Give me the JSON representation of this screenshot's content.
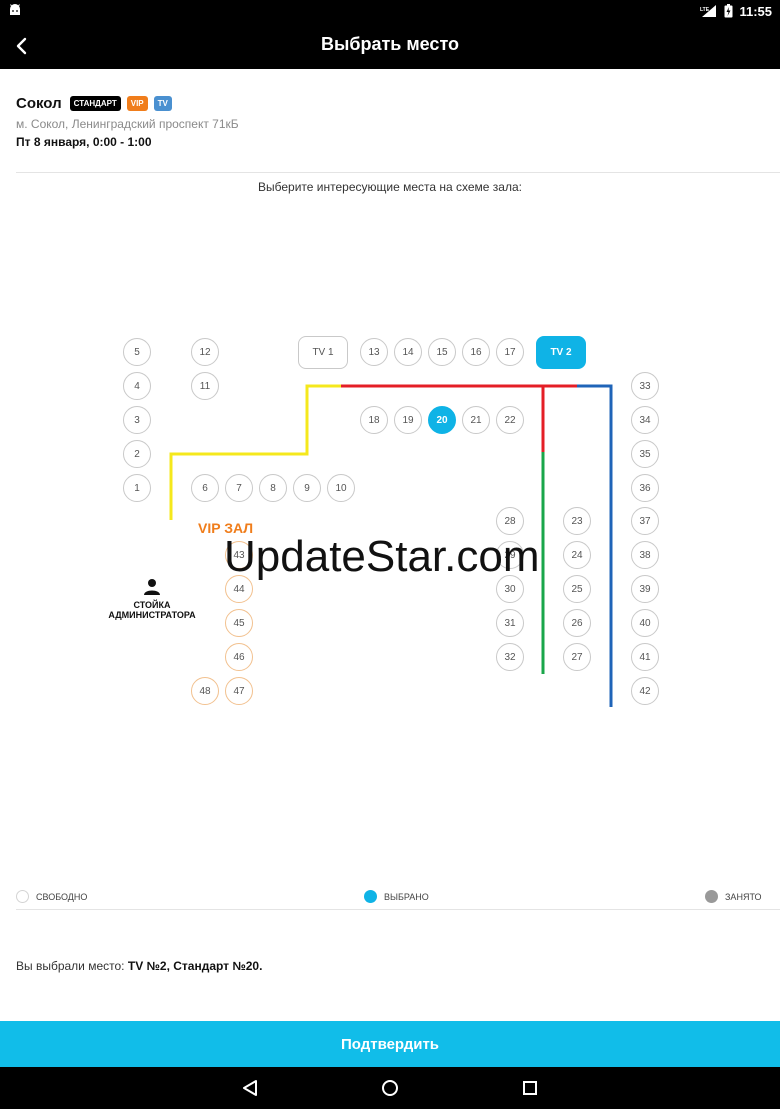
{
  "status_bar": {
    "time": "11:55",
    "network": "LTE"
  },
  "app_bar": {
    "title": "Выбрать место"
  },
  "venue": {
    "name": "Сокол",
    "badges": [
      "СТАНДАРТ",
      "VIP",
      "TV"
    ],
    "address": "м. Сокол, Ленинградский проспект 71кБ",
    "date": "Пт 8 января, 0:00 - 1:00"
  },
  "instruction": "Выберите интересующие места на схеме зала:",
  "hall": {
    "seats": [
      {
        "label": "5",
        "type": "standard",
        "state": "free"
      },
      {
        "label": "4",
        "type": "standard",
        "state": "free"
      },
      {
        "label": "3",
        "type": "standard",
        "state": "free"
      },
      {
        "label": "2",
        "type": "standard",
        "state": "free"
      },
      {
        "label": "1",
        "type": "standard",
        "state": "free"
      },
      {
        "label": "12",
        "type": "standard",
        "state": "free"
      },
      {
        "label": "11",
        "type": "standard",
        "state": "free"
      },
      {
        "label": "TV 1",
        "type": "tv",
        "state": "free"
      },
      {
        "label": "13",
        "type": "standard",
        "state": "free"
      },
      {
        "label": "14",
        "type": "standard",
        "state": "free"
      },
      {
        "label": "15",
        "type": "standard",
        "state": "free"
      },
      {
        "label": "16",
        "type": "standard",
        "state": "free"
      },
      {
        "label": "17",
        "type": "standard",
        "state": "free"
      },
      {
        "label": "TV 2",
        "type": "tv",
        "state": "selected"
      },
      {
        "label": "18",
        "type": "standard",
        "state": "free"
      },
      {
        "label": "19",
        "type": "standard",
        "state": "free"
      },
      {
        "label": "20",
        "type": "standard",
        "state": "selected"
      },
      {
        "label": "21",
        "type": "standard",
        "state": "free"
      },
      {
        "label": "22",
        "type": "standard",
        "state": "free"
      },
      {
        "label": "6",
        "type": "standard",
        "state": "free"
      },
      {
        "label": "7",
        "type": "standard",
        "state": "free"
      },
      {
        "label": "8",
        "type": "standard",
        "state": "free"
      },
      {
        "label": "9",
        "type": "standard",
        "state": "free"
      },
      {
        "label": "10",
        "type": "standard",
        "state": "free"
      },
      {
        "label": "28",
        "type": "standard",
        "state": "free"
      },
      {
        "label": "29",
        "type": "standard",
        "state": "free"
      },
      {
        "label": "30",
        "type": "standard",
        "state": "free"
      },
      {
        "label": "31",
        "type": "standard",
        "state": "free"
      },
      {
        "label": "32",
        "type": "standard",
        "state": "free"
      },
      {
        "label": "23",
        "type": "standard",
        "state": "free"
      },
      {
        "label": "24",
        "type": "standard",
        "state": "free"
      },
      {
        "label": "25",
        "type": "standard",
        "state": "free"
      },
      {
        "label": "26",
        "type": "standard",
        "state": "free"
      },
      {
        "label": "27",
        "type": "standard",
        "state": "free"
      },
      {
        "label": "33",
        "type": "standard",
        "state": "free"
      },
      {
        "label": "34",
        "type": "standard",
        "state": "free"
      },
      {
        "label": "35",
        "type": "standard",
        "state": "free"
      },
      {
        "label": "36",
        "type": "standard",
        "state": "free"
      },
      {
        "label": "37",
        "type": "standard",
        "state": "free"
      },
      {
        "label": "38",
        "type": "standard",
        "state": "free"
      },
      {
        "label": "39",
        "type": "standard",
        "state": "free"
      },
      {
        "label": "40",
        "type": "standard",
        "state": "free"
      },
      {
        "label": "41",
        "type": "standard",
        "state": "free"
      },
      {
        "label": "42",
        "type": "standard",
        "state": "free"
      },
      {
        "label": "43",
        "type": "vip",
        "state": "free"
      },
      {
        "label": "44",
        "type": "vip",
        "state": "free"
      },
      {
        "label": "45",
        "type": "vip",
        "state": "free"
      },
      {
        "label": "46",
        "type": "vip",
        "state": "free"
      },
      {
        "label": "47",
        "type": "vip",
        "state": "free"
      },
      {
        "label": "48",
        "type": "vip",
        "state": "free"
      }
    ],
    "vip_label": "VIP ЗАЛ",
    "admin_label_line1": "СТОЙКА",
    "admin_label_line2": "АДМИНИСТРАТОРА",
    "line_colors": {
      "yellow": "#f5e81c",
      "red": "#e41e26",
      "green": "#1aa64a",
      "blue": "#1f64b8",
      "white": "#ffffff"
    }
  },
  "watermark": "UpdateStar.com",
  "legend": {
    "free": "СВОБОДНО",
    "selected": "ВЫБРАНО",
    "busy": "ЗАНЯТО"
  },
  "summary": {
    "prefix": "Вы выбрали место:",
    "choice": "TV №2,  Стандарт №20."
  },
  "confirm_label": "Подтвердить",
  "colors": {
    "accent": "#11bde9",
    "selected_seat": "#0fb3e6",
    "vip": "#f07d1b"
  }
}
